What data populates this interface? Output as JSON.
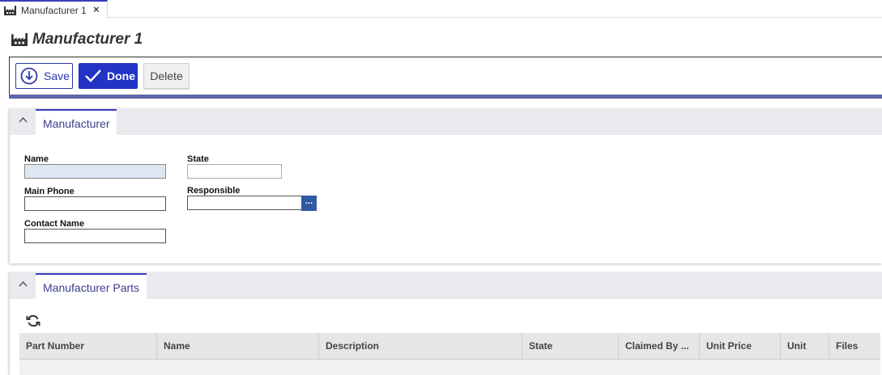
{
  "tab": {
    "label": "Manufacturer 1",
    "close": "×"
  },
  "page": {
    "title": "Manufacturer 1"
  },
  "toolbar": {
    "save_label": "Save",
    "done_label": "Done",
    "delete_label": "Delete"
  },
  "section_manufacturer": {
    "tab_label": "Manufacturer",
    "fields": {
      "name": {
        "label": "Name",
        "value": ""
      },
      "state": {
        "label": "State",
        "value": ""
      },
      "main_phone": {
        "label": "Main Phone",
        "value": ""
      },
      "responsible": {
        "label": "Responsible",
        "value": "",
        "lookup": "···"
      },
      "contact_name": {
        "label": "Contact Name",
        "value": ""
      }
    }
  },
  "section_parts": {
    "tab_label": "Manufacturer Parts",
    "columns": [
      "Part Number",
      "Name",
      "Description",
      "State",
      "Claimed By ...",
      "Unit Price",
      "Unit",
      "Files"
    ],
    "rows": []
  },
  "icons": {
    "tab_icon": "factory-icon",
    "title_icon": "factory-icon",
    "save_icon": "circle-arrow-down-icon",
    "done_icon": "check-icon",
    "collapse_icon": "chevron-up-icon",
    "refresh_icon": "refresh-icon"
  },
  "colors": {
    "accent": "#2233c6",
    "toolbar_underline": "#5d66a8",
    "tab_accent": "#3a3db8",
    "lookup": "#2f5aa3"
  }
}
